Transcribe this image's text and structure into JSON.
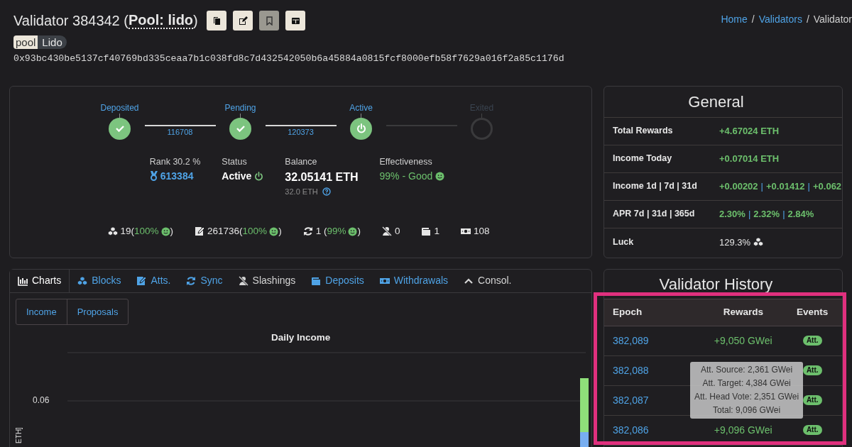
{
  "header": {
    "title": "Validator 384342 (",
    "pool_link": "Pool: lido",
    "title_end": ")",
    "actions": [
      {
        "kind": "copy",
        "disabled": false
      },
      {
        "kind": "edit",
        "disabled": false
      },
      {
        "kind": "bookmark",
        "disabled": true
      },
      {
        "kind": "table",
        "disabled": false
      }
    ],
    "badge": {
      "key": "pool",
      "value": "Lido"
    },
    "pubkey": "0x93bc430be5137cf40769bd335ceaa7b1c038fd8c7d432542050b6a45884a0815fcf8000efb58f7629a016f2a85c1176d"
  },
  "breadcrumb": [
    {
      "label": "Home",
      "kind": "link"
    },
    {
      "label": "/",
      "kind": "separator"
    },
    {
      "label": "Validators",
      "kind": "link"
    },
    {
      "label": "/",
      "kind": "separator"
    },
    {
      "label": "Validator",
      "kind": "current"
    }
  ],
  "lifecycle": {
    "steps": [
      {
        "label": "Deposited",
        "done": true,
        "current": false
      },
      {
        "label": "Pending",
        "done": true,
        "current": false
      },
      {
        "label": "Active",
        "done": false,
        "current": true
      },
      {
        "label": "Exited",
        "done": false,
        "current": false
      }
    ],
    "connectors": [
      {
        "epoch": "116708",
        "done": true
      },
      {
        "epoch": "120373",
        "done": true
      },
      {
        "done": false
      }
    ]
  },
  "summary": {
    "rank_label": "Rank 30.2 %",
    "rank": "613384",
    "status_label": "Status",
    "status": "Active",
    "balance_label": "Balance",
    "balance": "32.05141 ETH",
    "effective_balance": "32.0 ETH",
    "effectiveness_label": "Effectiveness",
    "effectiveness": "99% - Good"
  },
  "stats": [
    {
      "kind": "blocks",
      "value": "19(",
      "percent": "100%",
      "close": ")"
    },
    {
      "kind": "attestations",
      "value": "261736(",
      "percent": "100%",
      "close": ")"
    },
    {
      "kind": "sync",
      "value": "1 (",
      "percent": "99%",
      "close": ")"
    },
    {
      "kind": "slashings",
      "value": "0"
    },
    {
      "kind": "deposits",
      "value": "1"
    },
    {
      "kind": "withdrawals",
      "value": "108"
    }
  ],
  "general": {
    "title": "General",
    "rows": [
      {
        "label": "Total Rewards",
        "kind": "amount",
        "values": [
          "+4.67024 ETH"
        ]
      },
      {
        "label": "Income Today",
        "kind": "amount",
        "values": [
          "+0.07014 ETH"
        ]
      },
      {
        "label": "Income 1d | 7d | 31d",
        "kind": "amount",
        "values": [
          "+0.00202",
          "|",
          "+0.01412",
          "|",
          "+0.062"
        ]
      },
      {
        "label": "APR 7d | 31d | 365d",
        "kind": "amount",
        "values": [
          "2.30%",
          "|",
          "2.32%",
          "|",
          "2.84%"
        ]
      },
      {
        "label": "Luck",
        "kind": "luck",
        "values": [
          "129.3%"
        ]
      }
    ]
  },
  "tabs": [
    {
      "label": "Charts",
      "kind": "chart",
      "selected": true,
      "disabled": false
    },
    {
      "label": "Blocks",
      "kind": "blocks",
      "selected": false,
      "disabled": false
    },
    {
      "label": "Atts.",
      "kind": "attestations",
      "selected": false,
      "disabled": false
    },
    {
      "label": "Sync",
      "kind": "sync",
      "selected": false,
      "disabled": false
    },
    {
      "label": "Slashings",
      "kind": "slashings",
      "selected": false,
      "disabled": true
    },
    {
      "label": "Deposits",
      "kind": "deposits",
      "selected": false,
      "disabled": false
    },
    {
      "label": "Withdrawals",
      "kind": "withdrawals",
      "selected": false,
      "disabled": false
    },
    {
      "label": "Consol.",
      "kind": "caret",
      "selected": false,
      "disabled": true
    }
  ],
  "chart_tabs": [
    "Income",
    "Proposals"
  ],
  "chart": {
    "title": "Daily Income",
    "ytick": "0.06",
    "ylabel": "ETH]"
  },
  "history": {
    "title": "Validator History",
    "columns": [
      "Epoch",
      "Rewards",
      "Events"
    ],
    "rows": [
      {
        "epoch": "382,089",
        "rewards": "+9,050 GWei",
        "event": "Att."
      },
      {
        "epoch": "382,088",
        "event": "Att."
      },
      {
        "epoch": "382,087",
        "event": "Att."
      },
      {
        "epoch": "382,086",
        "rewards": "+9,096 GWei",
        "event": "Att."
      }
    ],
    "tooltip": [
      "Att. Source: 2,361 GWei",
      "Att. Target: 4,384 GWei",
      "Att. Head Vote: 2,351 GWei",
      "Total: 9,096 GWei"
    ],
    "highlighted": true
  }
}
